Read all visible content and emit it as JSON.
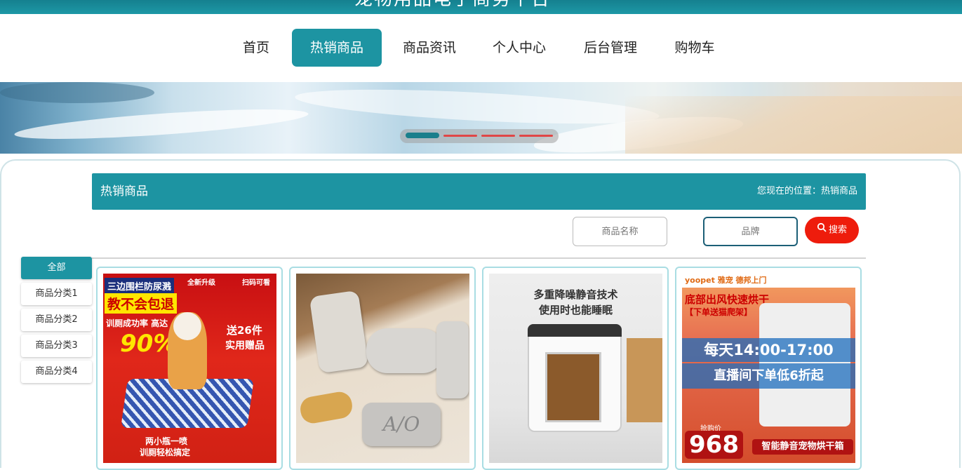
{
  "site": {
    "title": "宠物用品电子商务平台"
  },
  "nav": {
    "items": [
      {
        "label": "首页"
      },
      {
        "label": "热销商品",
        "active": true
      },
      {
        "label": "商品资讯"
      },
      {
        "label": "个人中心"
      },
      {
        "label": "后台管理"
      },
      {
        "label": "购物车"
      }
    ]
  },
  "banner": {
    "slides": 4,
    "active_slide": 1
  },
  "section": {
    "title": "热销商品",
    "breadcrumb": "您现在的位置：热销商品"
  },
  "search": {
    "name_placeholder": "商品名称",
    "brand_placeholder": "品牌",
    "button_label": "搜索"
  },
  "categories": [
    {
      "label": "全部",
      "active": true
    },
    {
      "label": "商品分类1"
    },
    {
      "label": "商品分类2"
    },
    {
      "label": "商品分类3"
    },
    {
      "label": "商品分类4"
    }
  ],
  "products": [
    {
      "texts": {
        "a": "三边围栏防尿溅",
        "b": "教不会包退",
        "c": "训厕成功率 高达",
        "d": "90%",
        "e": "送26件",
        "f": "实用赠品",
        "g": "全新升级",
        "h": "扫码可看",
        "i": "两小瓶一喷",
        "j": "训厕轻松搞定"
      }
    },
    {
      "texts": {
        "a": "A/O"
      }
    },
    {
      "texts": {
        "a": "多重降噪静音技术",
        "b": "使用时也能睡眠"
      }
    },
    {
      "texts": {
        "a": "yoopet 雅宠  德邦上门",
        "b": "底部出风快速烘干",
        "c": "【下单送猫爬架】",
        "d": "每天14:00-17:00",
        "e": "直播间下单低6折起",
        "f": "抢购价",
        "g": "968",
        "h": "智能静音宠物烘干箱"
      }
    }
  ],
  "colors": {
    "accent": "#1d94a2",
    "search_button": "#ee1c0c"
  }
}
